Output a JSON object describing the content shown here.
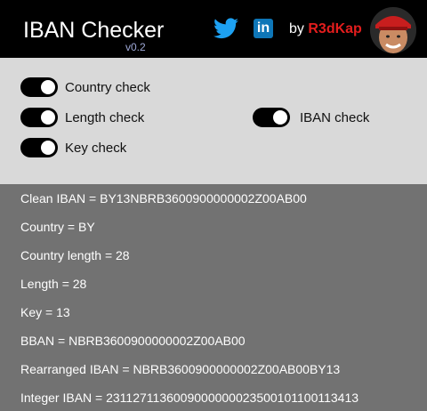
{
  "header": {
    "title": "IBAN Checker",
    "version": "v0.2",
    "by_label": "by",
    "author": "R3dKap"
  },
  "icons": {
    "twitter": "twitter-icon",
    "linkedin": "linkedin-icon"
  },
  "linkedin_label": "in",
  "toggles": [
    {
      "label": "Country check",
      "on": true
    },
    {
      "label": "Length check",
      "on": true
    },
    {
      "label": "IBAN check",
      "on": true
    },
    {
      "label": "Key check",
      "on": true
    }
  ],
  "results": [
    "Clean IBAN = BY13NBRB3600900000002Z00AB00",
    "Country = BY",
    "Country length = 28",
    "Length = 28",
    "Key = 13",
    "BBAN = NBRB3600900000002Z00AB00",
    "Rearranged IBAN = NBRB3600900000002Z00AB00BY13",
    "Integer IBAN = 2311271136009000000023500101100113413"
  ],
  "colors": {
    "header_bg": "#000000",
    "options_bg": "#d9d9d9",
    "results_bg": "#727272",
    "author_red": "#e31d1d",
    "twitter_blue": "#1da1f2",
    "linkedin_blue": "#0e76b7"
  }
}
